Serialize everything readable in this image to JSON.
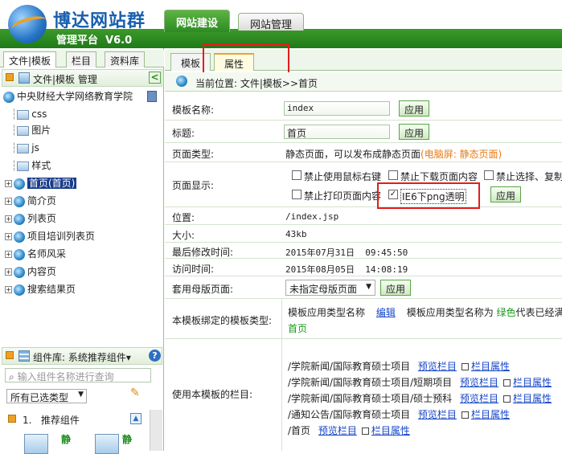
{
  "header": {
    "brand": "博达网站群",
    "subtitle": "管理平台  V6.0",
    "tabs": [
      {
        "label": "网站建设"
      },
      {
        "label": "网站管理"
      }
    ]
  },
  "left": {
    "tabs": [
      "文件|模板",
      "栏目",
      "资料库"
    ],
    "file_header": "文件|模板 管理",
    "collapse_glyph": "<",
    "site": "中央财经大学网络教育学院",
    "folders": [
      "css",
      "图片",
      "js",
      "样式"
    ],
    "pages": [
      "首页(首页)",
      "简介页",
      "列表页",
      "项目培训列表页",
      "名师风采",
      "内容页",
      "搜索结果页"
    ],
    "components": {
      "header": "组件库: 系统推荐组件▾",
      "help": "?",
      "search_placeholder": "输入组件名称进行查询",
      "select": "所有已选类型",
      "group": "1.   推荐组件",
      "item_tag": "静"
    }
  },
  "main": {
    "tabs": [
      "模板",
      "属性"
    ],
    "location": "当前位置: 文件|模板>>首页",
    "fields": {
      "name_label": "模板名称:",
      "name_value": "index",
      "title_label": "标题:",
      "title_value": "首页",
      "apply": "应用",
      "type_label": "页面类型:",
      "type_value": "静态页面，可以发布成静态页面",
      "type_note": "(电脑屏: 静态页面)",
      "display_label": "页面显示:",
      "options": [
        "禁止使用鼠标右键",
        "禁止下载页面内容",
        "禁止选择、复制",
        "禁止打印页面内容",
        "IE6下png透明"
      ],
      "location_label": "位置:",
      "location_value": "/index.jsp",
      "size_label": "大小:",
      "size_value": "43kb",
      "modified_label": "最后修改时间:",
      "modified_value": "2015年07月31日  09:45:50",
      "access_label": "访问时间:",
      "access_value": "2015年08月05日  14:08:19",
      "master_label": "套用母版页面:",
      "master_value": "未指定母版页面",
      "bound_label": "本模板绑定的模板类型:",
      "bound_prefix": "模板应用类型名称",
      "bound_edit": "编辑",
      "bound_text": "模板应用类型名称为",
      "bound_green": "绿色",
      "bound_tail": "代表已经满",
      "bound_home": "首页",
      "columns_label": "使用本模板的栏目:",
      "preview": "预览栏目",
      "attr": "栏目属性",
      "columns": [
        "/学院新闻/国际教育硕士项目",
        "/学院新闻/国际教育硕士项目/短期项目",
        "/学院新闻/国际教育硕士项目/硕士预科",
        "/通知公告/国际教育硕士项目",
        "/首页"
      ]
    }
  },
  "colors": {
    "accent": "#2e8a22",
    "highlight": "#e21d1d",
    "link": "#1646c8"
  }
}
